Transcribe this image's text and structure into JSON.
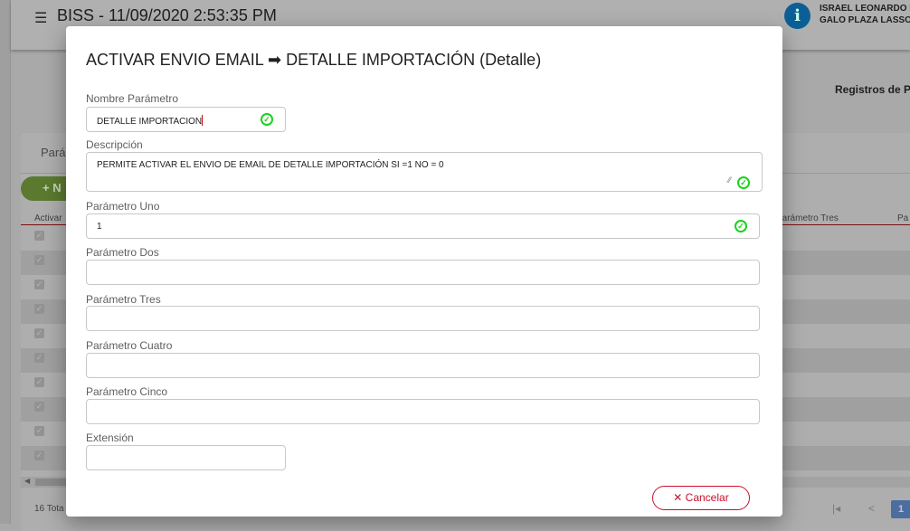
{
  "header": {
    "title": "BISS - 11/09/2020 2:53:35 PM",
    "user_line1": "ISRAEL LEONARDO I",
    "user_line2": "GALO PLAZA LASSO"
  },
  "background": {
    "registros_title": "Registros de P",
    "tab_label": "Parám",
    "new_button": "+ N",
    "columns": [
      "Activar",
      "Parámetro Tres",
      "Pa"
    ],
    "row_count": 10,
    "footer_total": "16 Tota",
    "pagination": {
      "first": "|◂",
      "prev": "<",
      "current": "1"
    }
  },
  "modal": {
    "title": "ACTIVAR ENVIO EMAIL ➡ DETALLE IMPORTACIÓN (Detalle)",
    "fields": {
      "nombre": {
        "label": "Nombre Parámetro",
        "value": "DETALLE IMPORTACION"
      },
      "descripcion": {
        "label": "Descripción",
        "value": "PERMITE ACTIVAR EL ENVIO DE EMAIL DE DETALLE IMPORTACIÓN SI =1 NO = 0"
      },
      "uno": {
        "label": "Parámetro Uno",
        "value": "1"
      },
      "dos": {
        "label": "Parámetro Dos",
        "value": ""
      },
      "tres": {
        "label": "Parámetro Tres",
        "value": ""
      },
      "cuatro": {
        "label": "Parámetro Cuatro",
        "value": ""
      },
      "cinco": {
        "label": "Parámetro Cinco",
        "value": ""
      },
      "extension": {
        "label": "Extensión",
        "value": ""
      }
    },
    "cancel_label": "✕ Cancelar"
  },
  "colors": {
    "valid": "#19d319",
    "cancel": "#c8102e",
    "info": "#0c5f96"
  }
}
